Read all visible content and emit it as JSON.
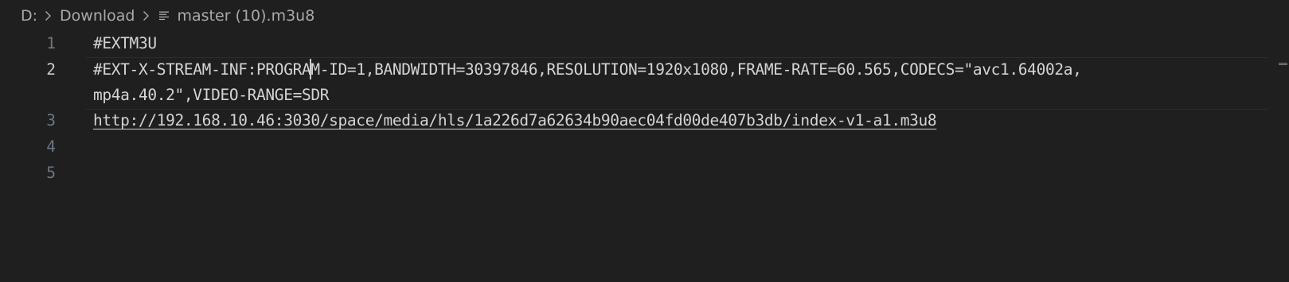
{
  "breadcrumb": {
    "drive": "D:",
    "folder": "Download",
    "file": "master (10).m3u8",
    "file_icon": "lines-file-icon"
  },
  "editor": {
    "line_numbers": [
      "1",
      "2",
      "3",
      "4",
      "5"
    ],
    "active_line": "2",
    "line1": "#EXTM3U",
    "line2_before_cursor": "#EXT-X-STREAM-INF:PROGRA",
    "line2_after_cursor": "M-ID=1,BANDWIDTH=30397846,RESOLUTION=1920x1080,FRAME-RATE=60.565,CODECS=\"avc1.64002a,",
    "line2_wrap": "mp4a.40.2\",VIDEO-RANGE=SDR",
    "line3": "http://192.168.10.46:3030/space/media/hls/1a226d7a62634b90aec04fd00de407b3db/index-v1-a1.m3u8",
    "line4": "",
    "line5": ""
  }
}
